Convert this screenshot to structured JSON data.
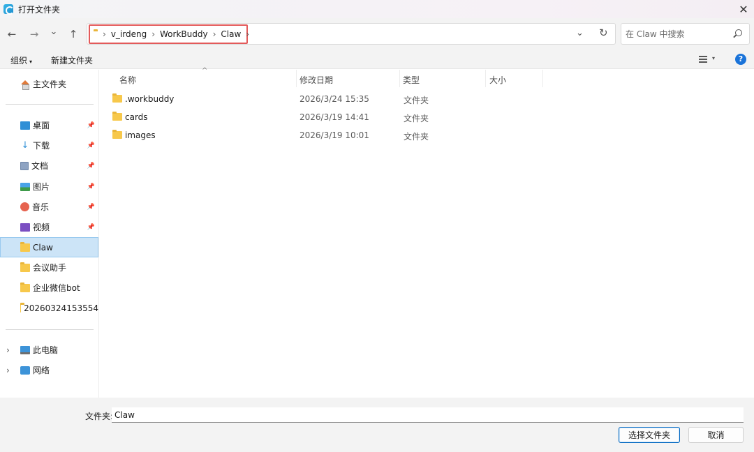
{
  "window": {
    "title": "打开文件夹",
    "close_glyph": "✕"
  },
  "nav": {
    "back_glyph": "←",
    "forward_glyph": "→",
    "recent_glyph": "⌄",
    "up_glyph": "↑",
    "breadcrumbs": [
      "v_irdeng",
      "WorkBuddy",
      "Claw"
    ],
    "crumb_sep": "›",
    "dropdown_glyph": "⌄",
    "refresh_glyph": "↻",
    "search_placeholder": "在 Claw 中搜索"
  },
  "toolbar": {
    "organize_label": "组织",
    "new_folder_label": "新建文件夹",
    "caret": "▾",
    "help_label": "?"
  },
  "sidebar": {
    "home_label": "主文件夹",
    "quick_access": [
      {
        "label": "桌面",
        "icon": "desktop-icon",
        "pinned": true
      },
      {
        "label": "下载",
        "icon": "download-icon",
        "pinned": true
      },
      {
        "label": "文档",
        "icon": "documents-icon",
        "pinned": true
      },
      {
        "label": "图片",
        "icon": "pictures-icon",
        "pinned": true
      },
      {
        "label": "音乐",
        "icon": "music-icon",
        "pinned": true
      },
      {
        "label": "视频",
        "icon": "videos-icon",
        "pinned": true
      },
      {
        "label": "Claw",
        "icon": "folder-icon",
        "pinned": false,
        "selected": true
      },
      {
        "label": "会议助手",
        "icon": "folder-icon",
        "pinned": false
      },
      {
        "label": "企业微信bot",
        "icon": "folder-icon",
        "pinned": false
      },
      {
        "label": "20260324153554",
        "icon": "folder-icon",
        "pinned": false
      }
    ],
    "pin_glyph": "📌",
    "this_pc_label": "此电脑",
    "network_label": "网络",
    "expander_glyph": "›",
    "download_glyph": "↓"
  },
  "columns": {
    "name": "名称",
    "modified": "修改日期",
    "type": "类型",
    "size": "大小",
    "sort_glyph": "^"
  },
  "files": [
    {
      "name": ".workbuddy",
      "modified": "2026/3/24 15:35",
      "type": "文件夹",
      "size": ""
    },
    {
      "name": "cards",
      "modified": "2026/3/19 14:41",
      "type": "文件夹",
      "size": ""
    },
    {
      "name": "images",
      "modified": "2026/3/19 10:01",
      "type": "文件夹",
      "size": ""
    }
  ],
  "footer": {
    "folder_label": "文件夹:",
    "folder_value": "Claw",
    "select_button": "选择文件夹",
    "cancel_button": "取消"
  },
  "colors": {
    "accent": "#0067c0",
    "selection": "#cce4f7",
    "highlight_box": "#e35a5a",
    "folder": "#f7c84b"
  }
}
